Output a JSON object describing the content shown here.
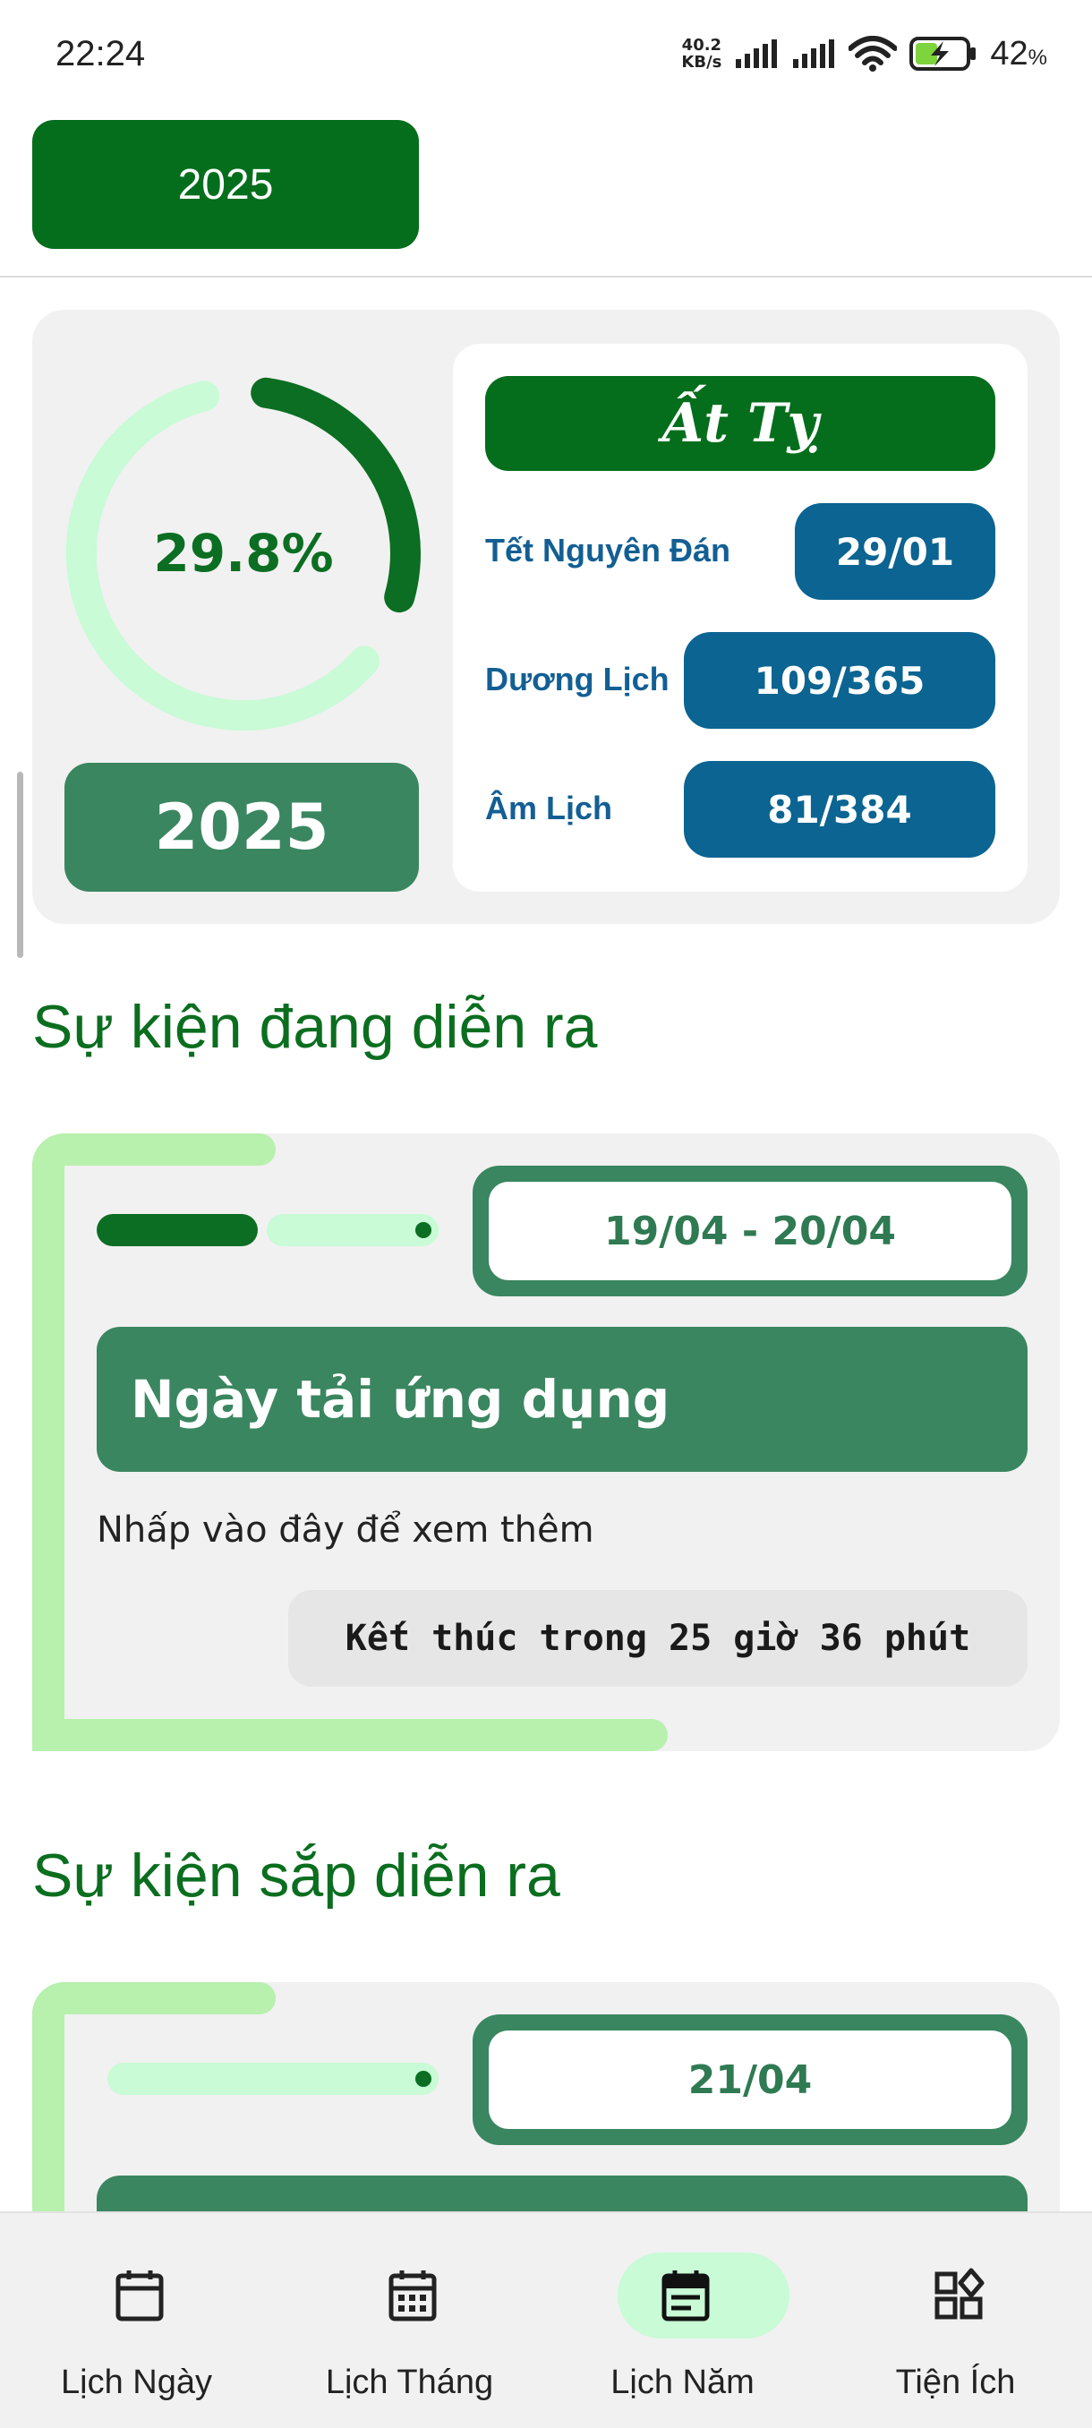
{
  "status_bar": {
    "time": "22:24",
    "net_speed_value": "40.2",
    "net_speed_unit": "KB/s",
    "battery_percent": "42",
    "battery_percent_sign": "%",
    "icons": [
      "signal-icon",
      "signal-icon",
      "wifi-icon",
      "battery-charging-icon"
    ]
  },
  "header": {
    "year_button": "2025"
  },
  "summary": {
    "progress_percent_label": "29.8%",
    "progress_fraction": 0.298,
    "year": "2025",
    "can_chi": "Ất Tỵ",
    "rows": [
      {
        "label": "Tết Nguyên Đán",
        "value": "29/01"
      },
      {
        "label": "Dương Lịch",
        "value": "109/365"
      },
      {
        "label": "Âm Lịch",
        "value": "81/384"
      }
    ]
  },
  "ongoing": {
    "section_title": "Sự kiện đang diễn ra",
    "event": {
      "date_range": "19/04 - 20/04",
      "title": "Ngày tải ứng dụng",
      "hint": "Nhấp vào đây để xem thêm",
      "countdown": "Kết thúc trong 25 giờ 36 phút"
    }
  },
  "upcoming": {
    "section_title": "Sự kiện sắp diễn ra",
    "event": {
      "date": "21/04"
    }
  },
  "bottom_nav": {
    "items": [
      {
        "label": "Lịch Ngày",
        "icon": "calendar-icon",
        "active": false
      },
      {
        "label": "Lịch Tháng",
        "icon": "calendar-month-icon",
        "active": false
      },
      {
        "label": "Lịch Năm",
        "icon": "calendar-year-icon",
        "active": true
      },
      {
        "label": "Tiện Ích",
        "icon": "widgets-icon",
        "active": false
      }
    ]
  },
  "colors": {
    "primary_green": "#056e1c",
    "medium_green": "#3a8660",
    "light_green": "#b8f0ae",
    "mint": "#c8fbd6",
    "blue": "#0b6491",
    "card_bg": "#f1f1f1"
  }
}
